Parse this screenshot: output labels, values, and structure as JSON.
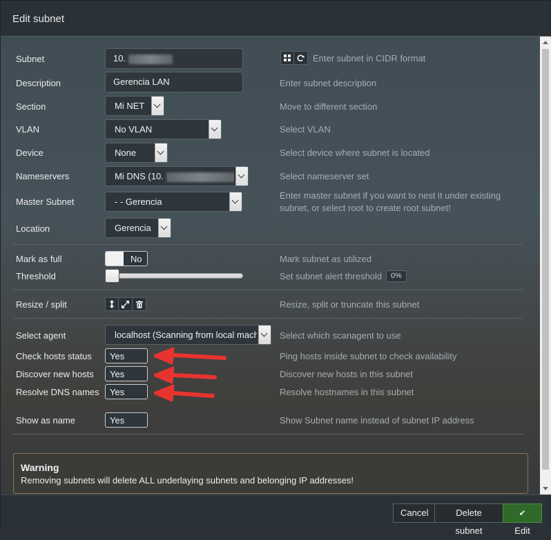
{
  "dialog": {
    "title": "Edit subnet"
  },
  "fields": {
    "subnet": {
      "label": "Subnet",
      "value": "10.",
      "help": "Enter subnet in CIDR format"
    },
    "description": {
      "label": "Description",
      "value": "Gerencia LAN",
      "help": "Enter subnet description"
    },
    "section": {
      "label": "Section",
      "value": "Mi NET",
      "help": "Move to different section"
    },
    "vlan": {
      "label": "VLAN",
      "value": "No VLAN",
      "help": "Select VLAN"
    },
    "device": {
      "label": "Device",
      "value": "None",
      "help": "Select device where subnet is located"
    },
    "nameservers": {
      "label": "Nameservers",
      "value": "Mi DNS (10.",
      "help": "Select nameserver set"
    },
    "master_subnet": {
      "label": "Master Subnet",
      "value": "- - Gerencia",
      "help_line1": "Enter master subnet if you want to nest it under existing",
      "help_line2": "subnet, or select root to create root subnet!"
    },
    "location": {
      "label": "Location",
      "value": "Gerencia"
    },
    "mark_as_full": {
      "label": "Mark as full",
      "value": "No",
      "help": "Mark subnet as utilized"
    },
    "threshold": {
      "label": "Threshold",
      "value": "0%",
      "level": 0,
      "help": "Set subnet alert threshold"
    },
    "resize": {
      "label": "Resize / split",
      "help": "Resize, split or truncate this subnet"
    },
    "agent": {
      "label": "Select agent",
      "value": "localhost (Scanning from local machine)",
      "help": "Select which scanagent to use"
    },
    "check_hosts": {
      "label": "Check hosts status",
      "value": "Yes",
      "help": "Ping hosts inside subnet to check availability"
    },
    "discover_hosts": {
      "label": "Discover new hosts",
      "value": "Yes",
      "help": "Discover new hosts in this subnet"
    },
    "resolve_dns": {
      "label": "Resolve DNS names",
      "value": "Yes",
      "help": "Resolve hostnames in this subnet"
    },
    "show_as_name": {
      "label": "Show as name",
      "value": "Yes",
      "help": "Show Subnet name instead of subnet IP address"
    }
  },
  "warning": {
    "title": "Warning",
    "message": "Removing subnets will delete ALL underlaying subnets and belonging IP addresses!"
  },
  "footer": {
    "cancel": "Cancel",
    "delete": "Delete subnet",
    "edit": "Edit"
  },
  "colors": {
    "arrow": "#e8342f",
    "success": "#2f6a2b"
  }
}
